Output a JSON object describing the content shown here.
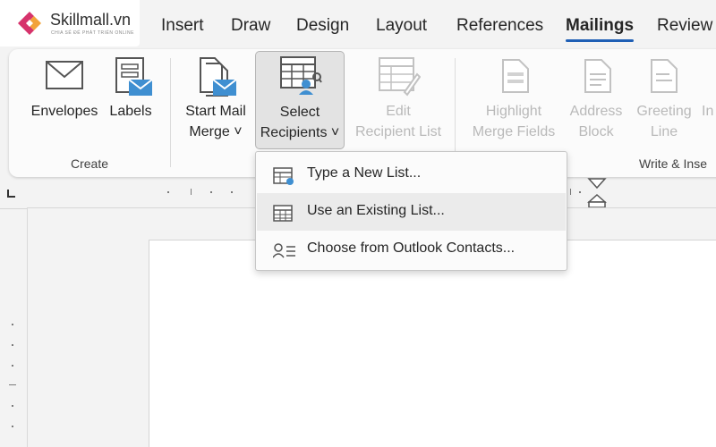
{
  "logo": {
    "name": "Skillmall.vn",
    "tagline": "CHIA SẺ ĐỂ PHÁT TRIỂN ONLINE"
  },
  "tabs": [
    {
      "label": "Insert",
      "active": false
    },
    {
      "label": "Draw",
      "active": false
    },
    {
      "label": "Design",
      "active": false
    },
    {
      "label": "Layout",
      "active": false
    },
    {
      "label": "References",
      "active": false
    },
    {
      "label": "Mailings",
      "active": true
    },
    {
      "label": "Review",
      "active": false
    }
  ],
  "ribbon": {
    "envelopes": "Envelopes",
    "labels": "Labels",
    "start_mail_merge": {
      "line1": "Start Mail",
      "line2": "Merge ˅"
    },
    "select_recipients": {
      "line1": "Select",
      "line2": "Recipients ˅"
    },
    "edit_recipient_list": {
      "line1": "Edit",
      "line2": "Recipient List"
    },
    "highlight_merge_fields": {
      "line1": "Highlight",
      "line2": "Merge Fields"
    },
    "address_block": {
      "line1": "Address",
      "line2": "Block"
    },
    "greeting_line": {
      "line1": "Greeting",
      "line2": "Line"
    },
    "insert_partial": "In",
    "groups": {
      "create": "Create",
      "write_insert": "Write & Inse"
    }
  },
  "dropdown": {
    "items": [
      {
        "label": "Type a New List..."
      },
      {
        "label": "Use an Existing List..."
      },
      {
        "label": "Choose from Outlook Contacts..."
      }
    ]
  },
  "colors": {
    "accent": "#1f5fb5",
    "icon_blue": "#3f8fd1",
    "logo_pink": "#d6336c",
    "logo_orange": "#f2a33a"
  }
}
